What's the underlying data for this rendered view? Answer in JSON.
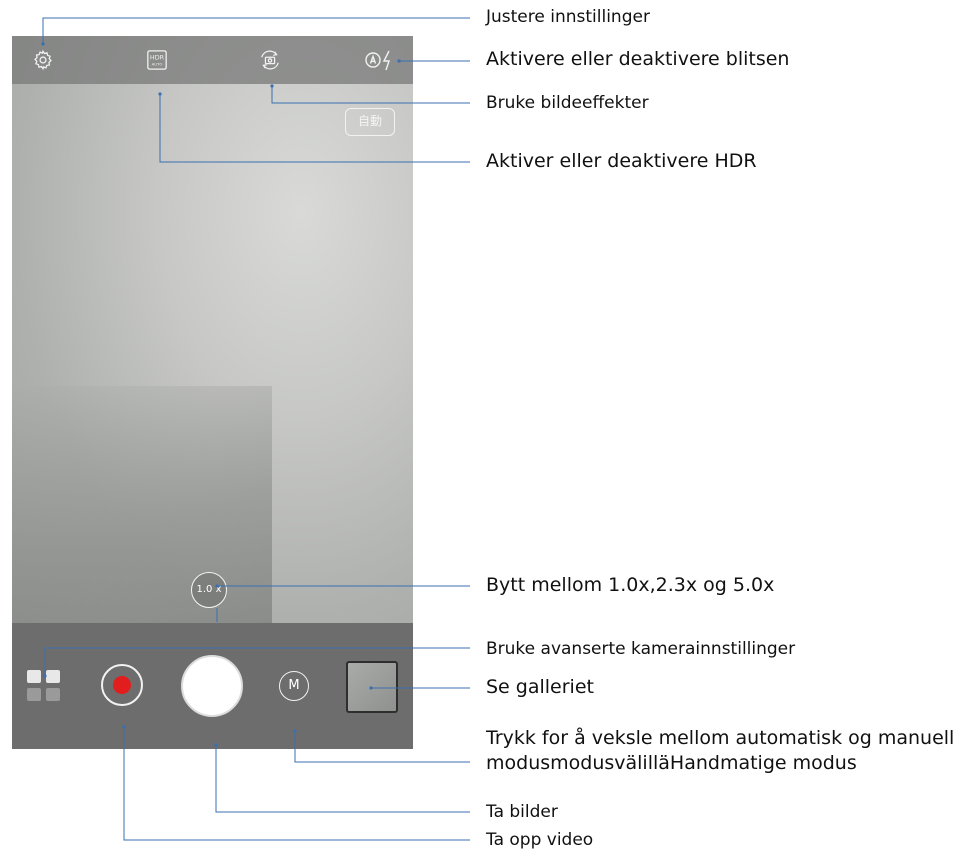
{
  "camera": {
    "top_bar": {
      "settings_icon": "gear-icon",
      "hdr_icon": "hdr-auto-icon",
      "hdr_text_top": "HDR",
      "hdr_text_bottom": "AUTO",
      "effects_icon": "camera-rotate-icon",
      "flash_icon": "auto-flash-icon"
    },
    "scene_mode_chip": "自動",
    "zoom_label": "1.0 x",
    "mode_button_label": "M",
    "record_dot_color": "#e21d1d"
  },
  "callouts": {
    "settings": "Justere innstillinger",
    "flash": "Aktivere eller deaktivere blitsen",
    "effects": "Bruke bildeeffekter",
    "hdr": "Aktiver eller deaktivere HDR",
    "zoom": "Bytt mellom 1.0x,2.3x og 5.0x",
    "advanced": "Bruke avanserte kamerainnstillinger",
    "gallery": "Se galleriet",
    "mode_line1": "Trykk for å veksle mellom automatisk og manuell",
    "mode_line2": "modusmodusvälilläHandmatige modus",
    "photo": "Ta bilder",
    "video": "Ta opp video"
  }
}
